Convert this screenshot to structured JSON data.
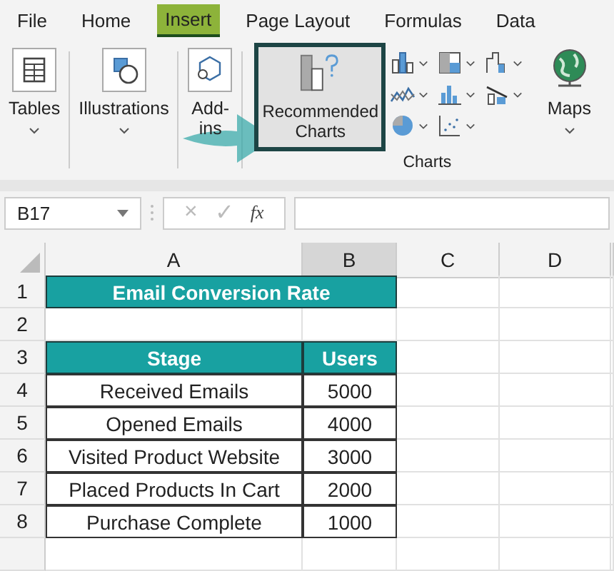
{
  "menu_tabs": [
    {
      "label": "File",
      "selected": false
    },
    {
      "label": "Home",
      "selected": false
    },
    {
      "label": "Insert",
      "selected": true
    },
    {
      "label": "Page Layout",
      "selected": false
    },
    {
      "label": "Formulas",
      "selected": false
    },
    {
      "label": "Data",
      "selected": false
    }
  ],
  "ribbon": {
    "tables": {
      "label": "Tables"
    },
    "illustrations": {
      "label": "Illustrations"
    },
    "addins": {
      "label": "Add-\nins"
    },
    "recommended_charts": {
      "label": "Recommended\nCharts",
      "highlighted": true
    },
    "maps": {
      "label": "Maps"
    },
    "group_label": "Charts"
  },
  "formula_bar": {
    "name_box": "B17",
    "cancel": "×",
    "enter": "✓",
    "function": "fx"
  },
  "columns": [
    {
      "label": "A",
      "selected": false
    },
    {
      "label": "B",
      "selected": true
    },
    {
      "label": "C",
      "selected": false
    },
    {
      "label": "D",
      "selected": false
    }
  ],
  "rows": [
    {
      "number": "1",
      "kind": "title",
      "cells": [
        "Email Conversion Rate"
      ]
    },
    {
      "number": "2",
      "kind": "empty",
      "cells": []
    },
    {
      "number": "3",
      "kind": "header",
      "cells": [
        "Stage",
        "Users"
      ]
    },
    {
      "number": "4",
      "kind": "data",
      "cells": [
        "Received Emails",
        "5000"
      ]
    },
    {
      "number": "5",
      "kind": "data",
      "cells": [
        "Opened Emails",
        "4000"
      ]
    },
    {
      "number": "6",
      "kind": "data",
      "cells": [
        "Visited Product Website",
        "3000"
      ]
    },
    {
      "number": "7",
      "kind": "data",
      "cells": [
        "Placed Products In Cart",
        "2000"
      ]
    },
    {
      "number": "8",
      "kind": "data",
      "cells": [
        "Purchase Complete",
        "1000"
      ]
    }
  ]
}
